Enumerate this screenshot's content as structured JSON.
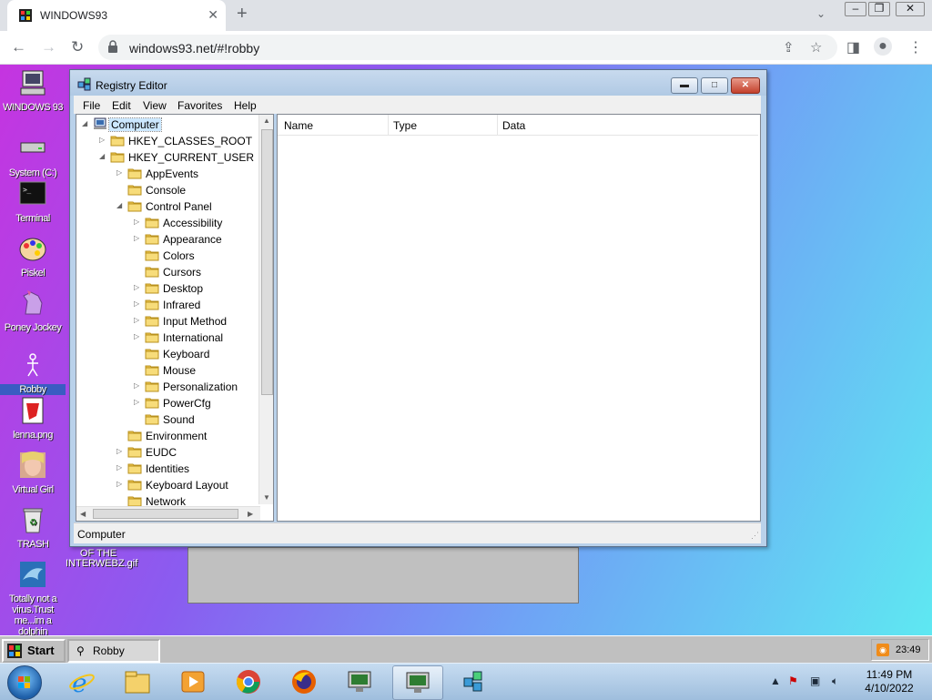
{
  "browser": {
    "tab_title": "WINDOWS93",
    "new_tab_symbol": "+",
    "close_tab_symbol": "✕",
    "url": "windows93.net/#!robby"
  },
  "desktop_icons": [
    {
      "id": "windows93",
      "label": "WINDOWS 93",
      "icon": "computer-icon"
    },
    {
      "id": "system",
      "label": "System (C:)",
      "icon": "drive-icon"
    },
    {
      "id": "terminal",
      "label": "Terminal",
      "icon": "terminal-icon"
    },
    {
      "id": "piskel",
      "label": "Piskel",
      "icon": "palette-icon"
    },
    {
      "id": "poney",
      "label": "Poney Jockey",
      "icon": "pony-icon"
    },
    {
      "id": "robby",
      "label": "Robby",
      "icon": "stickman-icon",
      "selected": true
    },
    {
      "id": "lenna",
      "label": "lenna.png",
      "icon": "image-file-icon"
    },
    {
      "id": "virtualgirl",
      "label": "Virtual Girl",
      "icon": "face-icon"
    },
    {
      "id": "trash",
      "label": "TRASH",
      "icon": "recycle-bin-icon"
    },
    {
      "id": "dolphin",
      "label": "Totally not a virus.Trust me...im a dolphin",
      "icon": "dolphin-icon"
    }
  ],
  "interwebz_label": "OF THE INTERWEBZ.gif",
  "registry": {
    "title": "Registry Editor",
    "menu": [
      "File",
      "Edit",
      "View",
      "Favorites",
      "Help"
    ],
    "tree": [
      {
        "label": "Computer",
        "level": 0,
        "expander": "◢",
        "selected": true
      },
      {
        "label": "HKEY_CLASSES_ROOT",
        "level": 1,
        "expander": "▷"
      },
      {
        "label": "HKEY_CURRENT_USER",
        "level": 1,
        "expander": "◢"
      },
      {
        "label": "AppEvents",
        "level": 2,
        "expander": "▷"
      },
      {
        "label": "Console",
        "level": 2,
        "expander": ""
      },
      {
        "label": "Control Panel",
        "level": 2,
        "expander": "◢"
      },
      {
        "label": "Accessibility",
        "level": 3,
        "expander": "▷"
      },
      {
        "label": "Appearance",
        "level": 3,
        "expander": "▷"
      },
      {
        "label": "Colors",
        "level": 3,
        "expander": ""
      },
      {
        "label": "Cursors",
        "level": 3,
        "expander": ""
      },
      {
        "label": "Desktop",
        "level": 3,
        "expander": "▷"
      },
      {
        "label": "Infrared",
        "level": 3,
        "expander": "▷"
      },
      {
        "label": "Input Method",
        "level": 3,
        "expander": "▷"
      },
      {
        "label": "International",
        "level": 3,
        "expander": "▷"
      },
      {
        "label": "Keyboard",
        "level": 3,
        "expander": ""
      },
      {
        "label": "Mouse",
        "level": 3,
        "expander": ""
      },
      {
        "label": "Personalization",
        "level": 3,
        "expander": "▷"
      },
      {
        "label": "PowerCfg",
        "level": 3,
        "expander": "▷"
      },
      {
        "label": "Sound",
        "level": 3,
        "expander": ""
      },
      {
        "label": "Environment",
        "level": 2,
        "expander": ""
      },
      {
        "label": "EUDC",
        "level": 2,
        "expander": "▷"
      },
      {
        "label": "Identities",
        "level": 2,
        "expander": "▷"
      },
      {
        "label": "Keyboard Layout",
        "level": 2,
        "expander": "▷"
      },
      {
        "label": "Network",
        "level": 2,
        "expander": ""
      }
    ],
    "columns": [
      "Name",
      "Type",
      "Data"
    ],
    "status": "Computer"
  },
  "w93_taskbar": {
    "start_label": "Start",
    "task_label": "Robby",
    "time": "23:49"
  },
  "win7_taskbar": {
    "apps": [
      "internet-explorer-icon",
      "file-explorer-icon",
      "media-player-icon",
      "chrome-icon",
      "firefox-icon",
      "monitor-icon",
      "monitor-icon",
      "network-cube-icon"
    ],
    "time": "11:49 PM",
    "date": "4/10/2022"
  }
}
